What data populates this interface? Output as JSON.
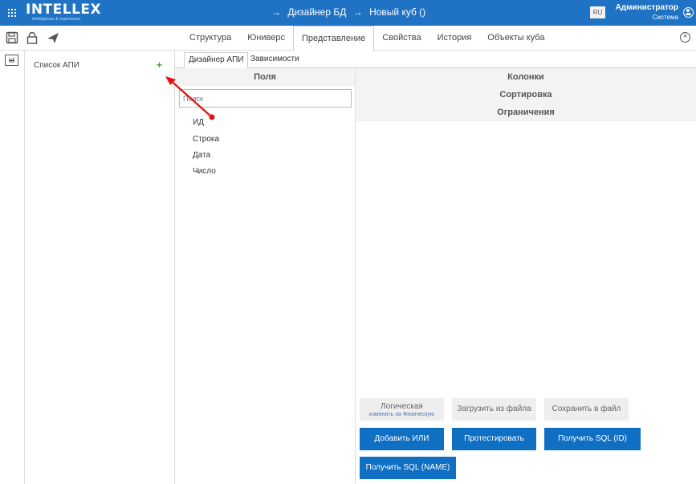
{
  "app": {
    "logo_text": "INTELLEX",
    "logo_tagline": "intelligence & experience",
    "breadcrumb": [
      "→",
      "Дизайнер БД",
      "→",
      "Новый куб ()"
    ],
    "lang": "RU",
    "user_name": "Администратор",
    "user_role": "Система"
  },
  "tabs": [
    "Структура",
    "Юниверс",
    "Представление",
    "Свойства",
    "История",
    "Объекты куба"
  ],
  "active_tab": "Представление",
  "left_strip": {
    "id_icon_label": "id"
  },
  "api_list": {
    "title": "Список АПИ",
    "add_label": "+"
  },
  "subtabs": [
    "Дизайнер АПИ",
    "Зависимости"
  ],
  "fields": {
    "header": "Поля",
    "search_placeholder": "Поиск",
    "items": [
      "ИД",
      "Строка",
      "Дата",
      "Число"
    ]
  },
  "right": {
    "sections": [
      "Колонки",
      "Сортировка",
      "Ограничения"
    ],
    "buttons": {
      "logical_main": "Логическая",
      "logical_sub": "изменить на Физическую",
      "load_file": "Загрузить из файла",
      "save_file": "Сохранить в файл",
      "add_or": "Добавить ИЛИ",
      "test": "Протестировать",
      "get_sql_id": "Получить SQL (ID)",
      "get_sql_name": "Получить SQL (NAME)"
    }
  },
  "colors": {
    "topbar": "#1f72c4",
    "primary_button": "#0e6fc3",
    "annotation": "#e01010",
    "add": "#3a9c3a"
  }
}
